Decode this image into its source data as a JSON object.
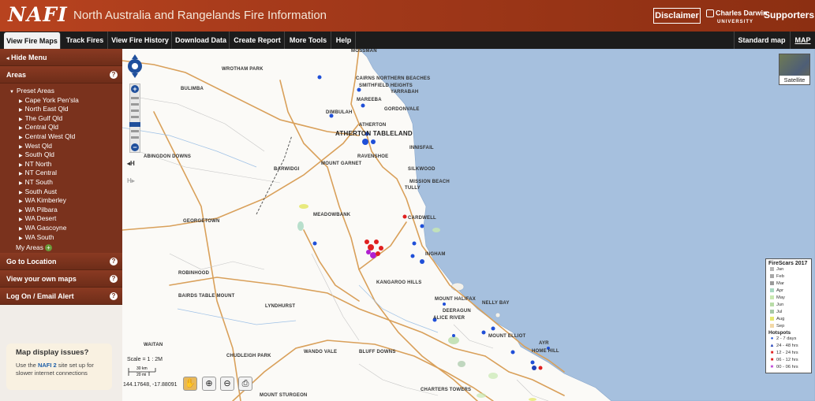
{
  "header": {
    "logo": "NAFI",
    "title": "North Australia and Rangelands Fire Information",
    "disclaimer": "Disclaimer",
    "university_line1": "Charles Darwin",
    "university_line2": "UNIVERSITY",
    "supporters": "Supporters"
  },
  "nav": {
    "tabs": [
      {
        "label": "View Fire Maps",
        "active": true
      },
      {
        "label": "Track Fires"
      },
      {
        "label": "View Fire History"
      },
      {
        "label": "Download Data"
      },
      {
        "label": "Create Report"
      },
      {
        "label": "More Tools"
      },
      {
        "label": "Help"
      }
    ],
    "standard_map": "Standard map",
    "map_button": "MAP"
  },
  "sidebar": {
    "hide_menu": "Hide Menu",
    "areas_title": "Areas",
    "preset_areas": "Preset Areas",
    "areas": [
      "Cape York Pen'sla",
      "North East Qld",
      "The Gulf Qld",
      "Central Qld",
      "Central West Qld",
      "West Qld",
      "South Qld",
      "NT North",
      "NT Central",
      "NT South",
      "South Aust",
      "WA Kimberley",
      "WA Pilbara",
      "WA Desert",
      "WA Gascoyne",
      "WA South"
    ],
    "my_areas": "My Areas",
    "go_to_location": "Go to Location",
    "view_your_own_maps": "View your own maps",
    "log_on": "Log On / Email Alert",
    "help_glyph": "?",
    "note_title": "Map display issues?",
    "note_pre": "Use the",
    "note_link": "NAFI 2",
    "note_post": "site set up for slower internet connections"
  },
  "map": {
    "places": [
      {
        "name": "MOSSMAN",
        "big": false
      },
      {
        "name": "CAIRNS NORTHERN BEACHES",
        "big": false
      },
      {
        "name": "SMITHFIELD HEIGHTS",
        "big": false
      },
      {
        "name": "YARRABAH",
        "big": false
      },
      {
        "name": "WROTHAM PARK",
        "big": false
      },
      {
        "name": "BULIMBA",
        "big": false
      },
      {
        "name": "MAREEBA",
        "big": false
      },
      {
        "name": "GORDONVALE",
        "big": false
      },
      {
        "name": "DIMBULAH",
        "big": false
      },
      {
        "name": "ATHERTON",
        "big": false
      },
      {
        "name": "ATHERTON TABLELAND",
        "big": true
      },
      {
        "name": "INNISFAIL",
        "big": false
      },
      {
        "name": "ABINGDON DOWNS",
        "big": false
      },
      {
        "name": "RAVENSHOE",
        "big": false
      },
      {
        "name": "MOUNT GARNET",
        "big": false
      },
      {
        "name": "SILKWOOD",
        "big": false
      },
      {
        "name": "BARWIDGI",
        "big": false
      },
      {
        "name": "MISSION BEACH",
        "big": false
      },
      {
        "name": "TULLY",
        "big": false
      },
      {
        "name": "MEADOWBANK",
        "big": false
      },
      {
        "name": "CARDWELL",
        "big": false
      },
      {
        "name": "GEORGETOWN",
        "big": false
      },
      {
        "name": "INGHAM",
        "big": false
      },
      {
        "name": "ROBINHOOD",
        "big": false
      },
      {
        "name": "KANGAROO HILLS",
        "big": false
      },
      {
        "name": "BAIRDS TABLE MOUNT",
        "big": false
      },
      {
        "name": "LYNDHURST",
        "big": false
      },
      {
        "name": "MOUNT HALIFAX",
        "big": false
      },
      {
        "name": "NELLY BAY",
        "big": false
      },
      {
        "name": "DEERAGUN",
        "big": false
      },
      {
        "name": "ALICE RIVER",
        "big": false
      },
      {
        "name": "MOUNT ELLIOT",
        "big": false
      },
      {
        "name": "AYR",
        "big": false
      },
      {
        "name": "HOME HILL",
        "big": false
      },
      {
        "name": "WAITAN",
        "big": false
      },
      {
        "name": "CHUDLEIGH PARK",
        "big": false
      },
      {
        "name": "WANDO VALE",
        "big": false
      },
      {
        "name": "BLUFF DOWNS",
        "big": false
      },
      {
        "name": "MOUNT STURGEON",
        "big": false
      },
      {
        "name": "CHARTERS TOWERS",
        "big": false
      }
    ],
    "satellite_label": "Satellite",
    "scale_text": "Scale = 1 : 2M",
    "scale_km": "30 km",
    "scale_mi": "20 mi",
    "coordinates": "144.17648, -17.88091",
    "pan_glyph": "✥",
    "zoom_in": "+",
    "zoom_out": "−",
    "hist_back": "◂H",
    "hist_fwd": "H▸",
    "tools": [
      {
        "name": "pan",
        "glyph": "✋"
      },
      {
        "name": "zoom-in",
        "glyph": "⊕"
      },
      {
        "name": "zoom-out",
        "glyph": "⊖"
      },
      {
        "name": "print",
        "glyph": "⎙"
      }
    ]
  },
  "legend": {
    "title": "FireScars 2017",
    "months": [
      {
        "label": "Jan",
        "color": "#b6b6b6"
      },
      {
        "label": "Feb",
        "color": "#a8a8a8"
      },
      {
        "label": "Mar",
        "color": "#9a9a9a"
      },
      {
        "label": "Apr",
        "color": "#a8d8c0"
      },
      {
        "label": "May",
        "color": "#c8e8b0"
      },
      {
        "label": "Jun",
        "color": "#b8dca8"
      },
      {
        "label": "Jul",
        "color": "#a6c8a6"
      },
      {
        "label": "Aug",
        "color": "#e6e870"
      },
      {
        "label": "Sep",
        "color": "#f2d8a8"
      }
    ],
    "hotspots_title": "Hotspots",
    "hotspots": [
      {
        "label": "2 - 7 days",
        "color": "#1f4fd8",
        "glyph": "●"
      },
      {
        "label": "24 - 48 hrs",
        "color": "#1f3fb8",
        "glyph": "▲"
      },
      {
        "label": "12 - 24 hrs",
        "color": "#e02020",
        "glyph": "■"
      },
      {
        "label": "06 - 12 hrs",
        "color": "#e02020",
        "glyph": "■"
      },
      {
        "label": "00 - 06 hrs",
        "color": "#b020d0",
        "glyph": "★"
      }
    ]
  }
}
